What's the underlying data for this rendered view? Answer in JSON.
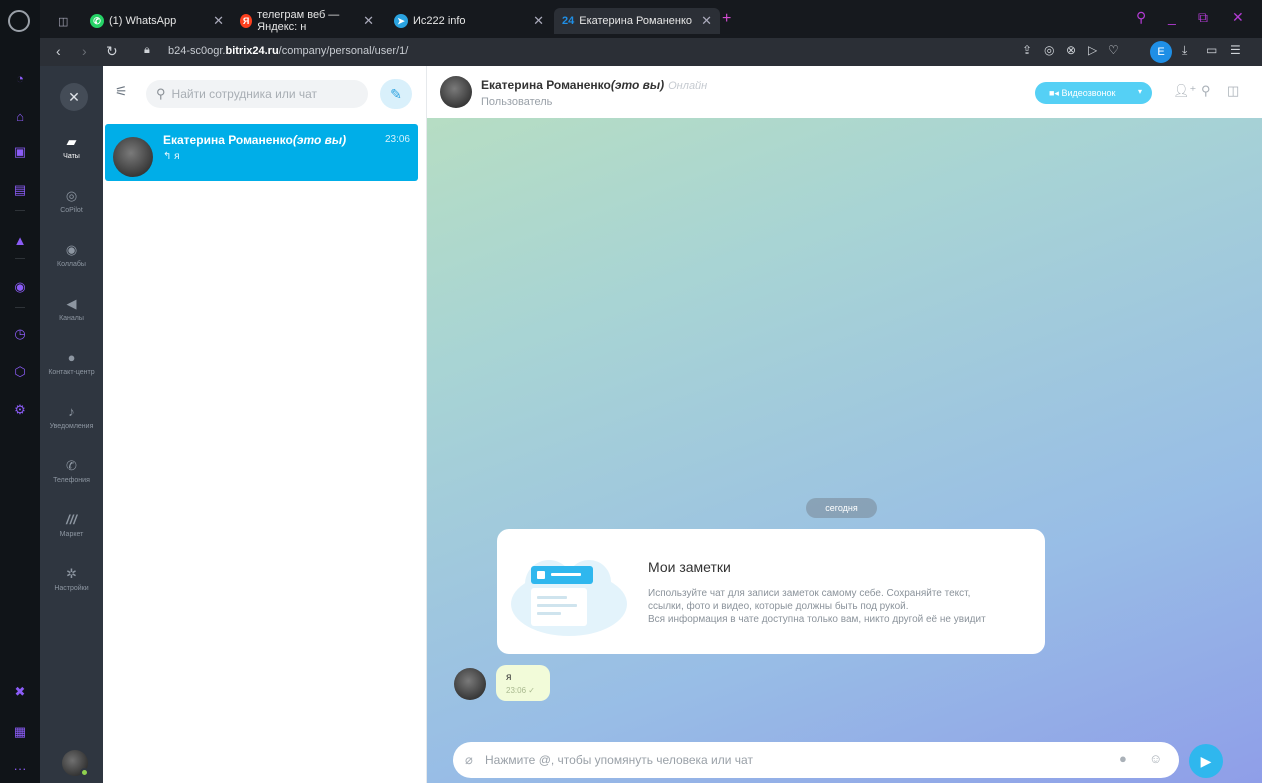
{
  "browser": {
    "tabs": [
      {
        "label": "(1) WhatsApp",
        "color": "#25d366"
      },
      {
        "label": "телеграм веб — Яндекс: н",
        "color": "#fc3f1d"
      },
      {
        "label": "Ис222 info",
        "color": "#2aa3e0"
      },
      {
        "label": "Екатерина Романенко",
        "color": "#1f8fe6",
        "badge": "24"
      }
    ],
    "url_prefix": "b24-sc0ogr.",
    "url_domain": "bitrix24.ru",
    "url_path": "/company/personal/user/1/",
    "profile_initial": "E"
  },
  "nav": {
    "items": [
      {
        "label": "Чаты",
        "icon": "chat-icon"
      },
      {
        "label": "CoPilot",
        "icon": "copilot-icon"
      },
      {
        "label": "Коллабы",
        "icon": "collab-icon"
      },
      {
        "label": "Каналы",
        "icon": "megaphone-icon"
      },
      {
        "label": "Контакт-центр",
        "icon": "contact-center-icon"
      },
      {
        "label": "Уведомления",
        "icon": "bell-icon"
      },
      {
        "label": "Телефония",
        "icon": "phone-icon"
      },
      {
        "label": "Маркет",
        "icon": "market-icon"
      },
      {
        "label": "Настройки",
        "icon": "gear-icon"
      }
    ]
  },
  "chatlist": {
    "search_placeholder": "Найти сотрудника или чат",
    "chats": [
      {
        "name": "Екатерина Романенко",
        "name_suffix": "(это вы)",
        "time": "23:06",
        "last": "я"
      }
    ]
  },
  "dialog": {
    "title": "Екатерина Романенко",
    "title_suffix": "(это вы)",
    "status": "Онлайн",
    "subtitle": "Пользователь",
    "video_button": "Видеозвонок",
    "date_label": "сегодня",
    "notes_title": "Мои заметки",
    "notes_line1": "Используйте чат для записи заметок самому себе. Сохраняйте текст,",
    "notes_line2": "ссылки, фото и видео, которые должны быть под рукой.",
    "notes_line3": "Вся информация в чате доступна только вам, никто другой её не увидит",
    "message_text": "я",
    "message_time": "23:06",
    "input_placeholder": "Нажмите @, чтобы упомянуть человека или чат"
  }
}
